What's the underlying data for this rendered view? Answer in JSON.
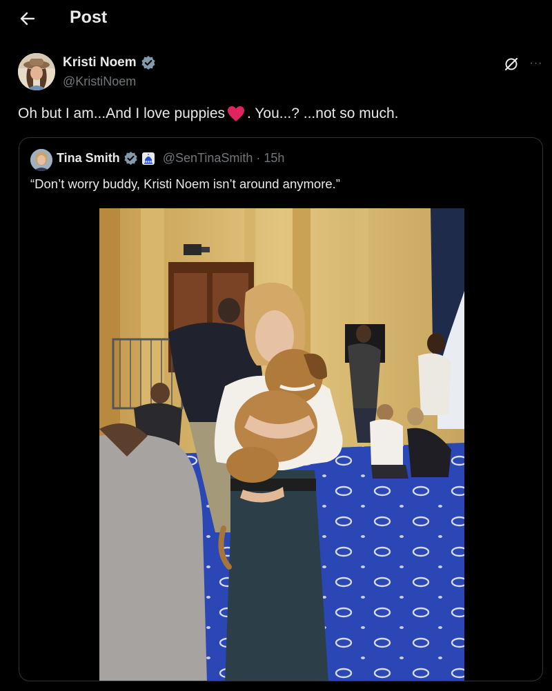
{
  "header": {
    "title": "Post",
    "back_icon": "arrow-left-icon"
  },
  "post": {
    "author_name": "Kristi Noem",
    "author_handle": "@KristiNoem",
    "verified_icon": "verified-badge-icon",
    "text_before": "Oh but I am...And I love puppies",
    "text_after": ". You...? ...not so much.",
    "emoji_icon": "red-heart-icon",
    "actions": {
      "grok_icon": "grok-icon",
      "more_label": "···"
    }
  },
  "quote": {
    "author_name": "Tina Smith",
    "author_handle": "@SenTinaSmith",
    "separator": "·",
    "time": "15h",
    "verified_icon": "verified-badge-icon",
    "affiliation_icon": "government-capitol-icon",
    "text": "“Don’t worry buddy, Kristi Noem isn’t around anymore.”",
    "photo_subject": "woman holding puppy in carpeted room"
  },
  "colors": {
    "background": "#000000",
    "text_primary": "#e7e9ea",
    "text_secondary": "#71767b",
    "border": "#2f3336",
    "verified": "#829aab",
    "heart": "#e0245e",
    "carpet": "#2b48b8"
  }
}
